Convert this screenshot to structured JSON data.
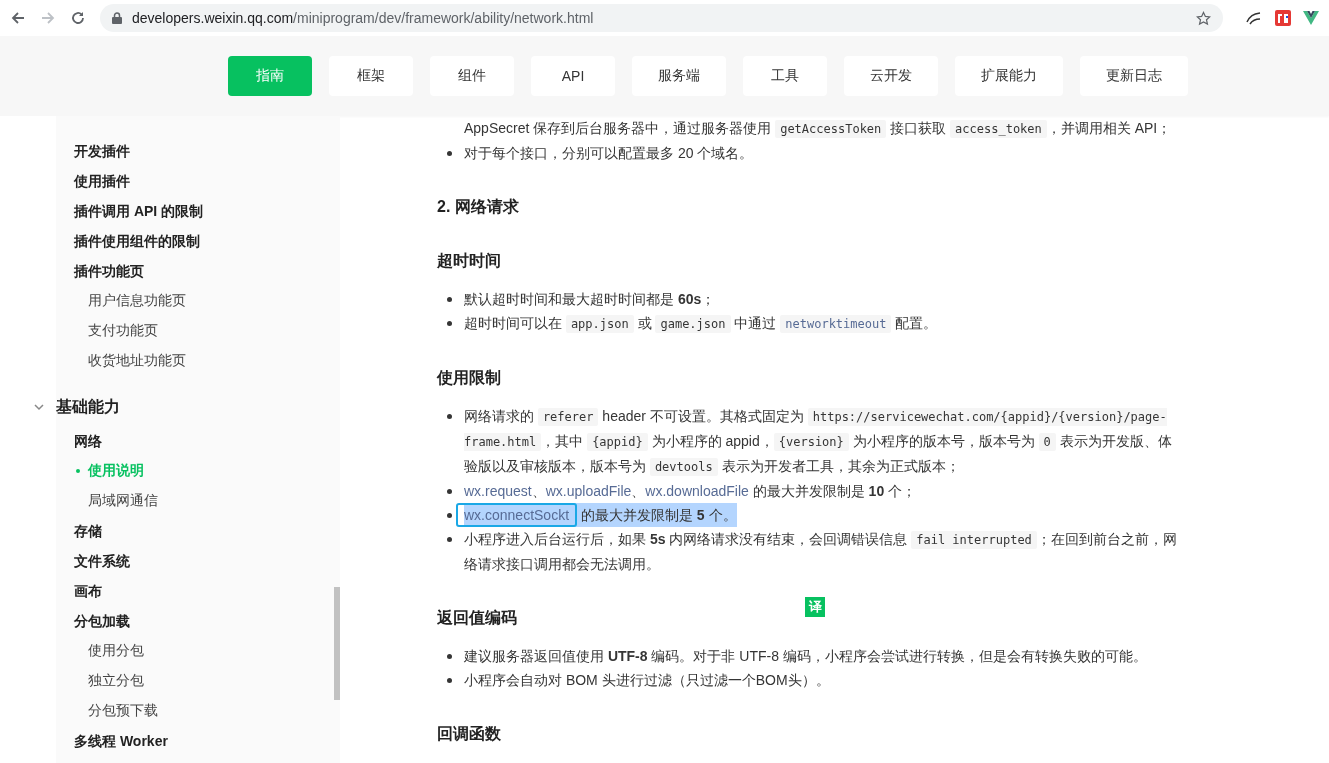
{
  "browser": {
    "url_host": "developers.weixin.qq.com",
    "url_path": "/miniprogram/dev/framework/ability/network.html"
  },
  "nav": [
    {
      "label": "指南",
      "selected": true
    },
    {
      "label": "框架",
      "selected": false
    },
    {
      "label": "组件",
      "selected": false
    },
    {
      "label": "API",
      "selected": false
    },
    {
      "label": "服务端",
      "selected": false
    },
    {
      "label": "工具",
      "selected": false
    },
    {
      "label": "云开发",
      "selected": false
    },
    {
      "label": "扩展能力",
      "selected": false
    },
    {
      "label": "更新日志",
      "selected": false
    }
  ],
  "sidebar": {
    "sections": [
      {
        "items": [
          {
            "label": "开发插件",
            "selected": false
          },
          {
            "label": "使用插件",
            "selected": false
          },
          {
            "label": "插件调用 API 的限制",
            "selected": false
          },
          {
            "label": "插件使用组件的限制",
            "selected": false
          },
          {
            "label": "插件功能页",
            "selected": false,
            "children": [
              {
                "label": "用户信息功能页",
                "selected": false
              },
              {
                "label": "支付功能页",
                "selected": false
              },
              {
                "label": "收货地址功能页",
                "selected": false
              }
            ]
          }
        ]
      },
      {
        "title": "基础能力",
        "expanded": true,
        "items": [
          {
            "label": "网络",
            "selected": false,
            "children": [
              {
                "label": "使用说明",
                "selected": true
              },
              {
                "label": "局域网通信",
                "selected": false
              }
            ]
          },
          {
            "label": "存储",
            "selected": false
          },
          {
            "label": "文件系统",
            "selected": false
          },
          {
            "label": "画布",
            "selected": false
          },
          {
            "label": "分包加载",
            "selected": false,
            "children": [
              {
                "label": "使用分包",
                "selected": false
              },
              {
                "label": "独立分包",
                "selected": false
              },
              {
                "label": "分包预下载",
                "selected": false
              }
            ]
          },
          {
            "label": "多线程 Worker",
            "selected": false
          }
        ]
      }
    ]
  },
  "content": [
    {
      "kind": "continuation",
      "parts": [
        {
          "kind": "text",
          "text": "AppSecret 保存到后台服务器中，通过服务器使用 "
        },
        {
          "kind": "code",
          "text": "getAccessToken"
        },
        {
          "kind": "text",
          "text": " 接口获取 "
        },
        {
          "kind": "code",
          "text": "access_token"
        },
        {
          "kind": "text",
          "text": "，并调用相关 API；"
        }
      ]
    },
    {
      "kind": "bullet",
      "parts": [
        {
          "kind": "text",
          "text": "对于每个接口，分别可以配置最多 20 个域名。"
        }
      ]
    },
    {
      "kind": "h2",
      "text": "2. 网络请求"
    },
    {
      "kind": "h3",
      "text": "超时时间"
    },
    {
      "kind": "bullet",
      "parts": [
        {
          "kind": "text",
          "text": "默认超时时间和最大超时时间都是 **60s**；"
        }
      ]
    },
    {
      "kind": "bullet",
      "parts": [
        {
          "kind": "text",
          "text": "超时时间可以在 "
        },
        {
          "kind": "code",
          "text": "app.json"
        },
        {
          "kind": "text",
          "text": " 或 "
        },
        {
          "kind": "code",
          "text": "game.json"
        },
        {
          "kind": "text",
          "text": " 中通过 "
        },
        {
          "kind": "code_link",
          "text": "networktimeout"
        },
        {
          "kind": "text",
          "text": " 配置。"
        }
      ]
    },
    {
      "kind": "h3",
      "text": "使用限制"
    },
    {
      "kind": "bullet",
      "parts": [
        {
          "kind": "text",
          "text": "网络请求的 "
        },
        {
          "kind": "code",
          "text": "referer"
        },
        {
          "kind": "text",
          "text": " header 不可设置。其格式固定为 "
        },
        {
          "kind": "code",
          "text": "https://servicewechat.com/{appid}/{version}/page-frame.html"
        },
        {
          "kind": "text",
          "text": "，其中 "
        },
        {
          "kind": "code",
          "text": "{appid}"
        },
        {
          "kind": "text",
          "text": " 为小程序的 appid，"
        },
        {
          "kind": "code",
          "text": "{version}"
        },
        {
          "kind": "text",
          "text": " 为小程序的版本号，版本号为 "
        },
        {
          "kind": "code",
          "text": "0"
        },
        {
          "kind": "text",
          "text": " 表示为开发版、体验版以及审核版本，版本号为 "
        },
        {
          "kind": "code",
          "text": "devtools"
        },
        {
          "kind": "text",
          "text": " 表示为开发者工具，其余为正式版本；"
        }
      ]
    },
    {
      "kind": "bullet",
      "parts": [
        {
          "kind": "link",
          "text": "wx.request"
        },
        {
          "kind": "text",
          "text": "、"
        },
        {
          "kind": "link",
          "text": "wx.uploadFile"
        },
        {
          "kind": "text",
          "text": "、"
        },
        {
          "kind": "link",
          "text": "wx.downloadFile"
        },
        {
          "kind": "text",
          "text": " 的最大并发限制是 **10** 个；"
        }
      ]
    },
    {
      "kind": "bullet",
      "highlighted": true,
      "parts": [
        {
          "kind": "link",
          "text": "wx.connectSockt",
          "framed": true
        },
        {
          "kind": "text",
          "text": " 的最大并发限制是 **5** 个。"
        }
      ]
    },
    {
      "kind": "bullet",
      "parts": [
        {
          "kind": "text",
          "text": "小程序进入后台运行后，如果 **5s** 内网络请求没有结束，会回调错误信息 "
        },
        {
          "kind": "code",
          "text": "fail interrupted"
        },
        {
          "kind": "text",
          "text": "；在回到前台之前，网络请求接口调用都会无法调用。"
        }
      ]
    },
    {
      "kind": "h3",
      "text": "返回值编码",
      "badge": "译"
    },
    {
      "kind": "bullet",
      "parts": [
        {
          "kind": "text",
          "text": "建议服务器返回值使用 **UTF-8** 编码。对于非 UTF-8 编码，小程序会尝试进行转换，但是会有转换失败的可能。"
        }
      ]
    },
    {
      "kind": "bullet",
      "parts": [
        {
          "kind": "text",
          "text": "小程序会自动对 BOM 头进行过滤（只过滤一个BOM头）。"
        }
      ]
    },
    {
      "kind": "h3",
      "text": "回调函数"
    }
  ]
}
